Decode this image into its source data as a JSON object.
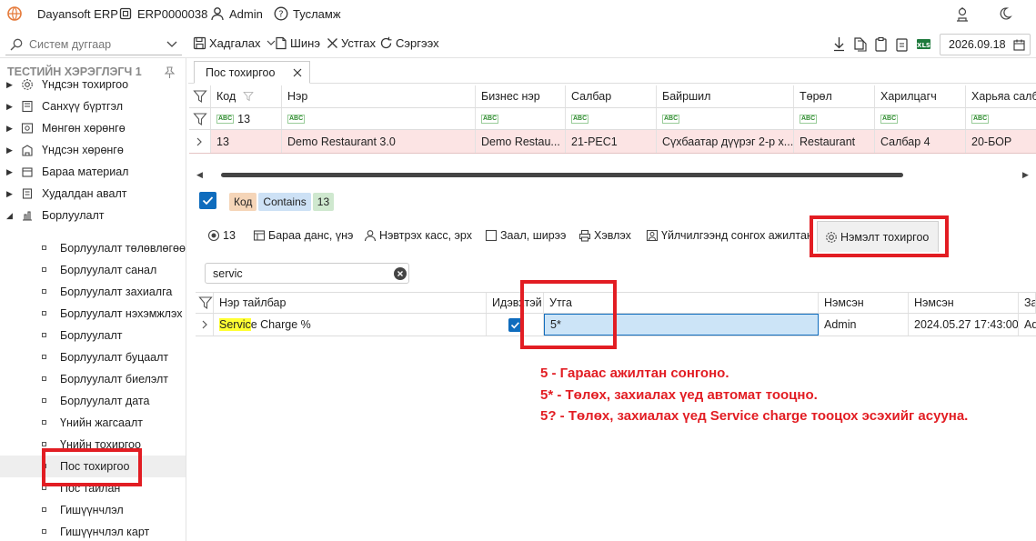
{
  "titlebar": {
    "app_name": "Dayansoft ERP",
    "db_name": "ERP0000038",
    "user": "Admin",
    "help": "Тусламж"
  },
  "toolbar": {
    "search_placeholder": "Систем дуггаар",
    "save_label": "Хадгалах",
    "new_label": "Шинэ",
    "delete_label": "Устгах",
    "refresh_label": "Сэргээх",
    "date": "2026.09.18"
  },
  "sidebar": {
    "user_title": "ТЕСТИЙН ХЭРЭГЛЭГЧ 1",
    "groups": [
      {
        "label": "Үндсэн тохиргоо",
        "icon": "gear-icon"
      },
      {
        "label": "Санхүү бүртгэл",
        "icon": "book-icon"
      },
      {
        "label": "Мөнгөн хөрөнгө",
        "icon": "money-icon"
      },
      {
        "label": "Үндсэн хөрөнгө",
        "icon": "building-icon"
      },
      {
        "label": "Бараа материал",
        "icon": "box-icon"
      },
      {
        "label": "Худалдан авалт",
        "icon": "cart-icon"
      },
      {
        "label": "Борлуулалт",
        "icon": "sales-icon"
      }
    ],
    "sub_items": [
      "Борлуулалт төлөвлөгөө",
      "Борлуулалт санал",
      "Борлуулалт захиалга",
      "Борлуулалт нэхэмжлэх",
      "Борлуулалт",
      "Борлуулалт буцаалт",
      "Борлуулалт биелэлт",
      "Борлуулалт дата",
      "Үнийн жагсаалт",
      "Үнийн тохиргоо",
      "Пос тохиргоо",
      "Пос тайлан",
      "Гишүүнчлэл",
      "Гишүүнчлэл карт"
    ]
  },
  "doc_tab": {
    "label": "Пос тохиргоо"
  },
  "grid": {
    "columns": [
      "Код",
      "Нэр",
      "Бизнес нэр",
      "Салбар",
      "Байршил",
      "Төрөл",
      "Харилцагч",
      "Харьяа салб"
    ],
    "filter_code": "13",
    "row": [
      "13",
      "Demo Restaurant 3.0",
      "Demo Restau...",
      "21-PEC1",
      "Сүхбаатар дүүрэг 2-р х...",
      "Restaurant",
      "Салбар 4",
      "20-БОР"
    ]
  },
  "filter_chips": {
    "field": "Код",
    "op": "Contains",
    "value": "13"
  },
  "sub_tabs": [
    {
      "label": "13",
      "icon": "radio-icon"
    },
    {
      "label": "Бараа данс, үнэ",
      "icon": "ledger-icon"
    },
    {
      "label": "Нэвтрэх касс, эрх",
      "icon": "user-icon"
    },
    {
      "label": "Заал, ширээ",
      "icon": "square-icon"
    },
    {
      "label": "Хэвлэх",
      "icon": "printer-icon"
    },
    {
      "label": "Үйлчилгээнд сонгох ажилтан",
      "icon": "user-card-icon"
    },
    {
      "label": "Нэмэлт тохиргоо",
      "icon": "gear-icon"
    }
  ],
  "settings": {
    "search_value": "servic",
    "columns": [
      "Нэр тайлбар",
      "Идэвхтэй",
      "Утга",
      "Нэмсэн",
      "Нэмсэн",
      "За"
    ],
    "row": {
      "name_highlight": "Servic",
      "name_rest": "e Charge %",
      "active": true,
      "value": "5*",
      "added_by": "Admin",
      "added_at": "2024.05.27 17:43:00",
      "extra": "Ad"
    }
  },
  "annotations": [
    "5 - Гараас ажилтан сонгоно.",
    "5* - Төлөх, захиалах үед автомат тооцно.",
    "5? - Төлөх, захиалах үед Service charge тооцох эсэхийг асууна."
  ],
  "colors": {
    "accent": "#0f6cbd",
    "highlight_row": "#fce4e4",
    "annotation": "#e21d23",
    "edit_cell": "#cce4f7"
  }
}
